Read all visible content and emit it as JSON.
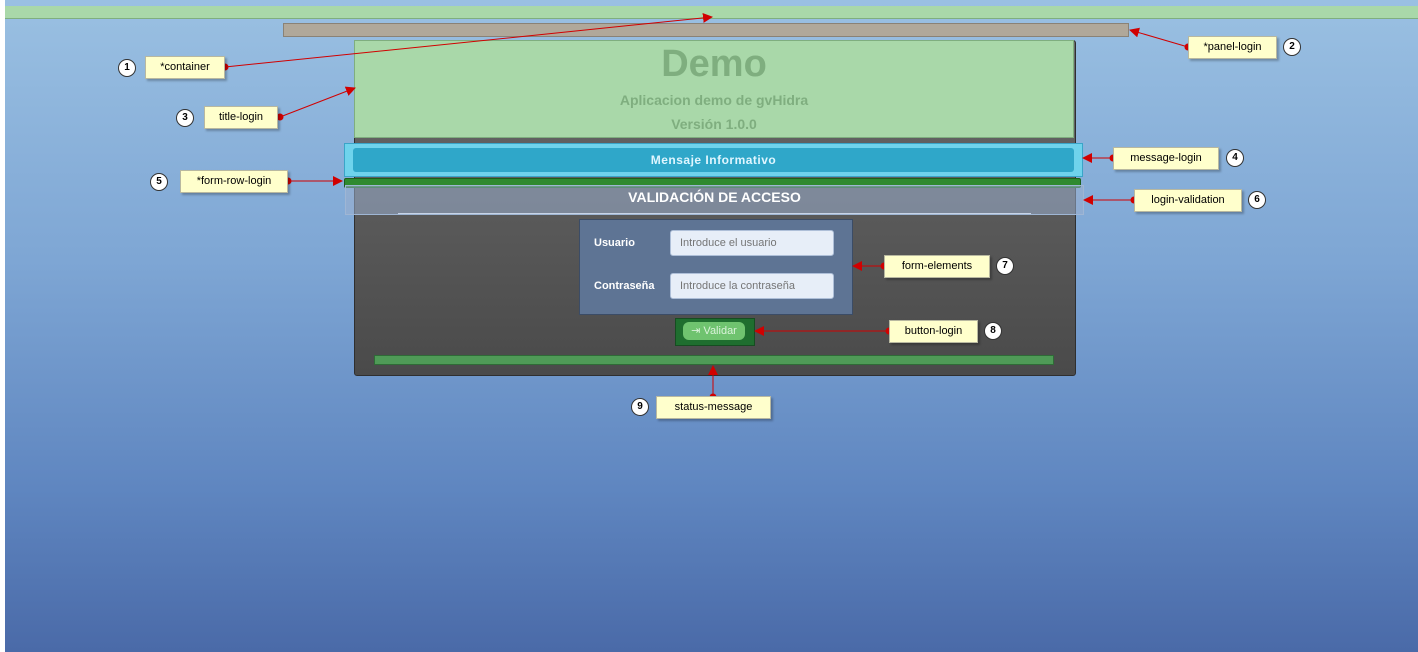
{
  "title_login": {
    "title": "Demo",
    "subtitle": "Aplicacion demo de gvHidra",
    "version": "Versión 1.0.0"
  },
  "message_login": {
    "text": "Mensaje Informativo"
  },
  "login_validation": {
    "title": "VALIDACIÓN DE ACCESO"
  },
  "form": {
    "user_label": "Usuario",
    "user_placeholder": "Introduce el usuario",
    "password_label": "Contraseña",
    "password_placeholder": "Introduce la contraseña"
  },
  "button_login": {
    "label": "Validar"
  },
  "annotations": [
    {
      "number": "1",
      "label": "*container"
    },
    {
      "number": "2",
      "label": "*panel-login"
    },
    {
      "number": "3",
      "label": "title-login"
    },
    {
      "number": "4",
      "label": "message-login"
    },
    {
      "number": "5",
      "label": "*form-row-login"
    },
    {
      "number": "6",
      "label": "login-validation"
    },
    {
      "number": "7",
      "label": "form-elements"
    },
    {
      "number": "8",
      "label": "button-login"
    },
    {
      "number": "9",
      "label": "status-message"
    }
  ],
  "colors": {
    "background_top": "#9ac0e2",
    "background_bottom": "#4a6aa8",
    "highlight_green": "#a9d8a9",
    "info_blue": "#2fa7c9",
    "callout_yellow": "#ffffcc",
    "arrow_red": "#d10000"
  }
}
